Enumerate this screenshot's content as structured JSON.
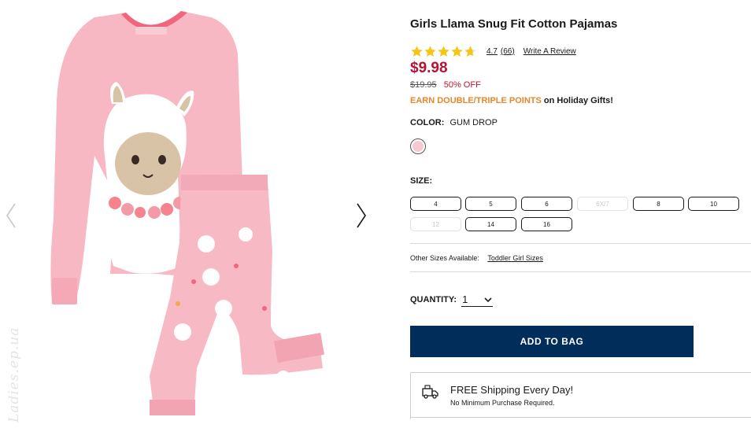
{
  "gallery": {
    "prev_icon": "chevron-left-icon",
    "next_icon": "chevron-right-icon",
    "image_alt": "Girls Llama Snug Fit Cotton Pajamas - pink top with llama applique and llama print pants",
    "watermark": "Ladies.ep.ua"
  },
  "product": {
    "title": "Girls Llama Snug Fit Cotton Pajamas",
    "rating": 4.7,
    "rating_label": "4.7",
    "review_count": "(66)",
    "write_review": "Write A Review",
    "price": "$9.98",
    "was_price": "$19.95",
    "discount": "50% OFF",
    "promo_accent": "EARN DOUBLE/TRIPLE POINTS",
    "promo_rest": " on Holiday Gifts!"
  },
  "color": {
    "label": "COLOR:",
    "value": "GUM DROP",
    "swatch_color": "#f7c9d3"
  },
  "size": {
    "label": "SIZE:",
    "options": [
      {
        "label": "4",
        "available": true
      },
      {
        "label": "5",
        "available": true
      },
      {
        "label": "6",
        "available": true
      },
      {
        "label": "6X/7",
        "available": false
      },
      {
        "label": "8",
        "available": true
      },
      {
        "label": "10",
        "available": true
      },
      {
        "label": "12",
        "available": false
      },
      {
        "label": "14",
        "available": true
      },
      {
        "label": "16",
        "available": true
      }
    ]
  },
  "other_sizes": {
    "label": "Other Sizes Available:",
    "link": "Toddler Girl Sizes"
  },
  "quantity": {
    "label": "QUANTITY:",
    "value": "1"
  },
  "cart": {
    "add_label": "ADD TO BAG",
    "button_color": "#012d5a"
  },
  "shipping": {
    "title": "FREE Shipping Every Day!",
    "subtitle": "No Minimum Purchase Required.",
    "icon": "delivery-truck-icon"
  },
  "colors": {
    "price": "#b71234",
    "promo": "#e8862b",
    "star": "#f5c518"
  }
}
